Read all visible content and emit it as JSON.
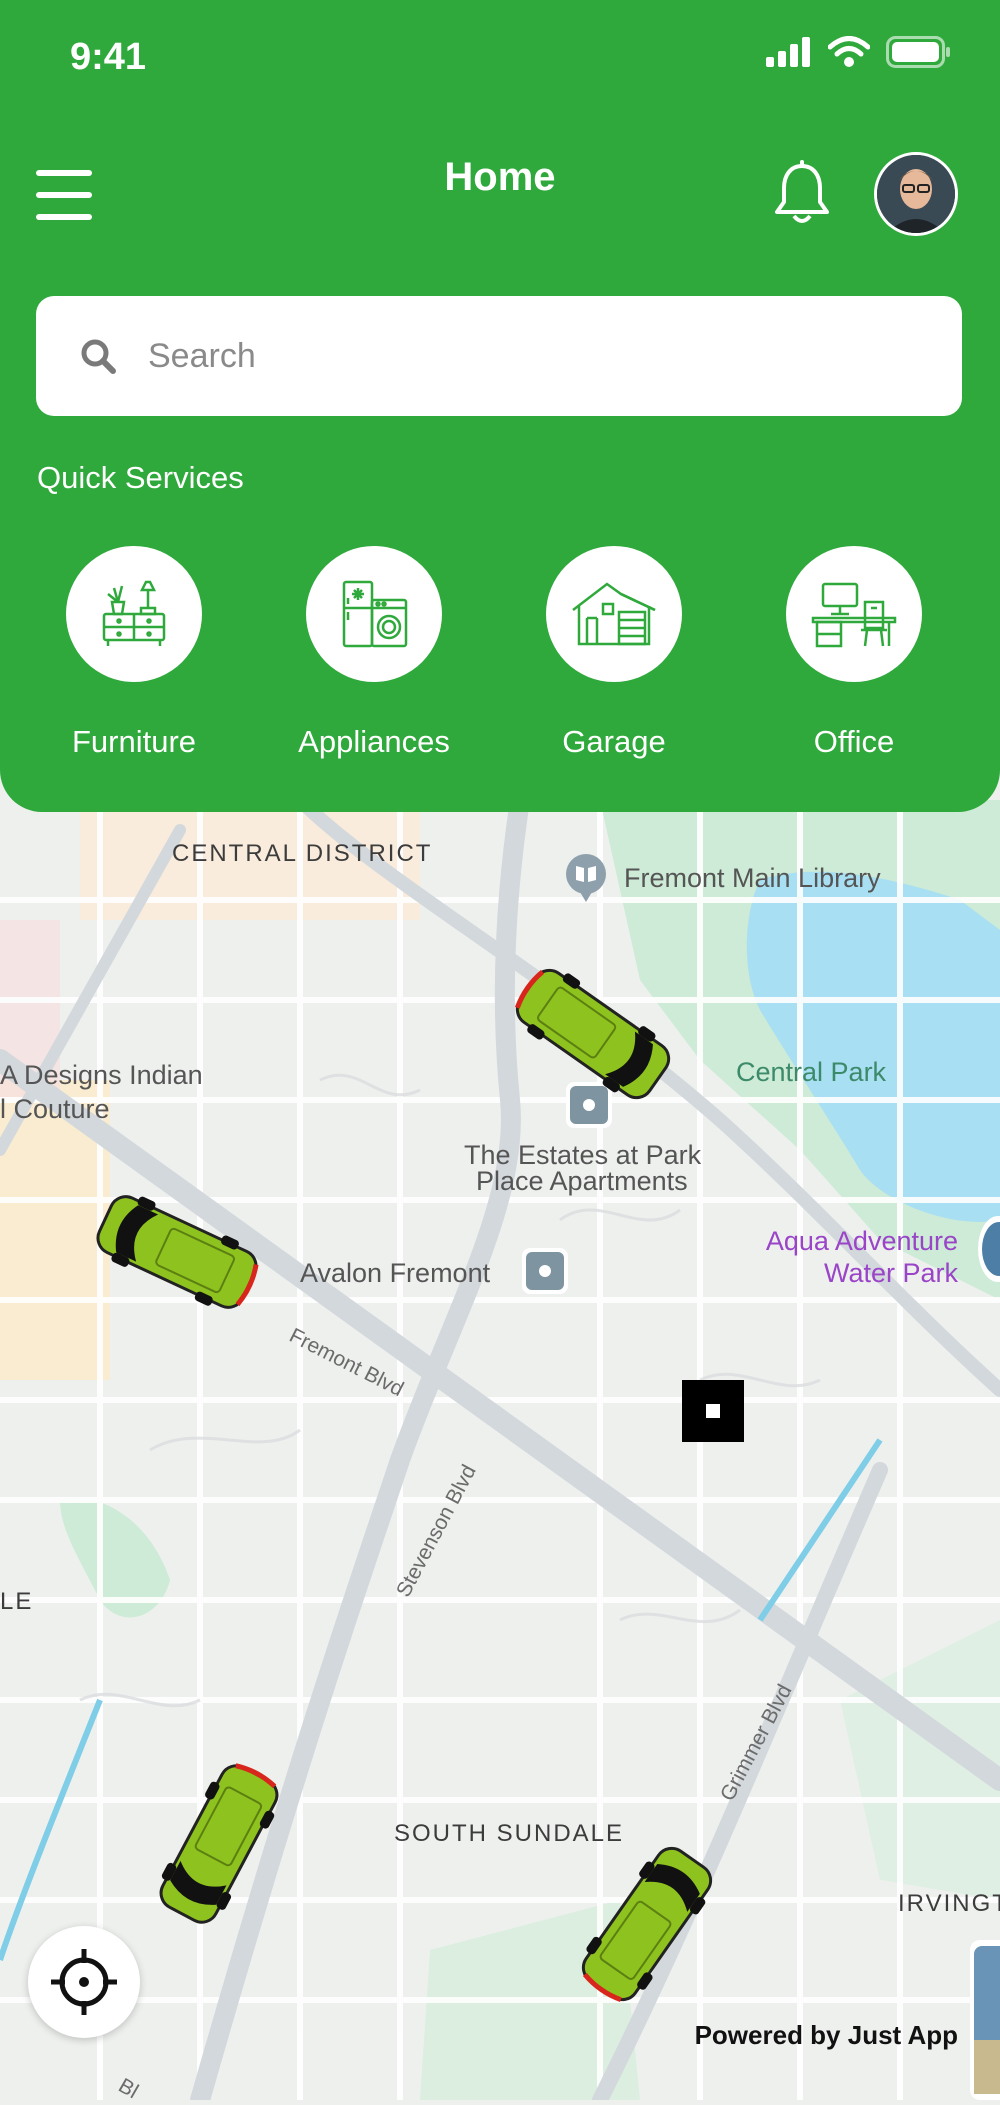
{
  "status_bar": {
    "time": "9:41"
  },
  "header": {
    "title": "Home"
  },
  "search": {
    "placeholder": "Search"
  },
  "quick_services": {
    "label": "Quick Services",
    "items": [
      {
        "label": "Furniture",
        "icon": "furniture-icon"
      },
      {
        "label": "Appliances",
        "icon": "appliances-icon"
      },
      {
        "label": "Garage",
        "icon": "garage-icon"
      },
      {
        "label": "Office",
        "icon": "office-icon"
      }
    ]
  },
  "map": {
    "labels": {
      "central_district": "CENTRAL DISTRICT",
      "library": "Fremont Main Library",
      "designs_1": "A Designs Indian",
      "designs_2": "l Couture",
      "central_park": "Central Park",
      "estates_1": "The Estates at Park",
      "estates_2": "Place Apartments",
      "aqua_1": "Aqua Adventure",
      "aqua_2": "Water Park",
      "avalon": "Avalon Fremont",
      "fremont_blvd": "Fremont Blvd",
      "stevenson_blvd": "Stevenson Blvd",
      "le": "LE",
      "south_sundale": "SOUTH SUNDALE",
      "grimmer_blvd": "Grimmer Blvd",
      "irvington": "IRVINGT",
      "bottom_blvd": "Bl"
    }
  },
  "footer": {
    "powered_by": "Powered by Just App"
  },
  "colors": {
    "brand_green": "#2fa93b",
    "car_green": "#8dc21f"
  }
}
